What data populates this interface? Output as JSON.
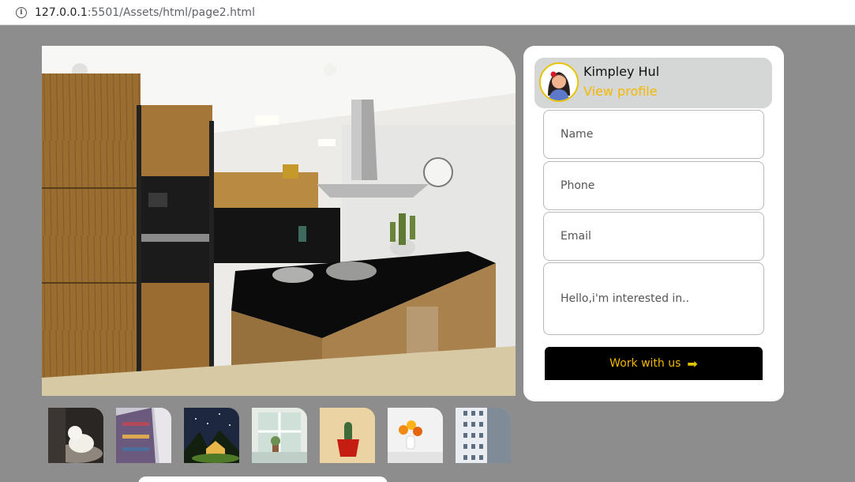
{
  "browser": {
    "url_host": "127.0.0.1",
    "url_rest": ":5501/Assets/html/page2.html"
  },
  "hero": {
    "icon": "kitchen-photo"
  },
  "thumbnails": [
    {
      "icon": "dog-photo"
    },
    {
      "icon": "fabric-photo"
    },
    {
      "icon": "night-cabin-photo"
    },
    {
      "icon": "window-plants-photo"
    },
    {
      "icon": "cactus-pot-photo"
    },
    {
      "icon": "flower-vase-photo"
    },
    {
      "icon": "building-facade-photo"
    }
  ],
  "profile": {
    "name": "Kimpley Hul",
    "link": "View profile"
  },
  "form": {
    "name_placeholder": "Name",
    "phone_placeholder": "Phone",
    "email_placeholder": "Email",
    "message_placeholder": "Hello,i'm interested in..",
    "submit_label": "Work with us",
    "submit_icon": "➡"
  },
  "colors": {
    "accent": "#f5b800",
    "background": "#8c8d8c",
    "button_bg": "#000000"
  }
}
